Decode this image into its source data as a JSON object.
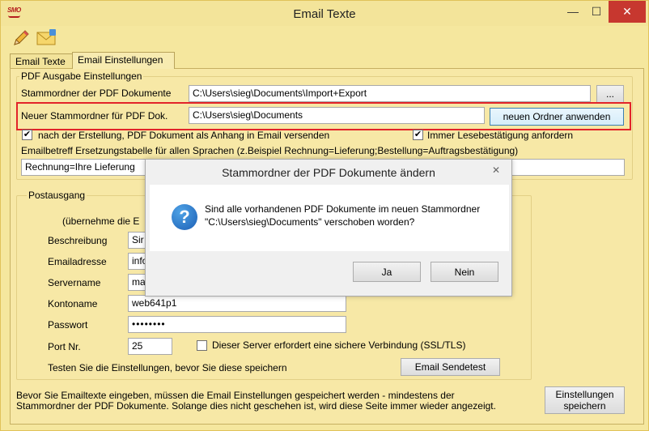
{
  "window": {
    "title": "Email Texte",
    "logo_text": "SMO"
  },
  "title_controls": {
    "minimize": "—",
    "maximize": "☐",
    "close": "✕"
  },
  "toolbar": {
    "edit_icon": "pencil-icon",
    "mail_icon": "envelope-icon"
  },
  "tabs": [
    {
      "label": "Email Texte"
    },
    {
      "label": "Email Einstellungen"
    }
  ],
  "pdf": {
    "group_label": "PDF Ausgabe Einstellungen",
    "root_label": "Stammordner der PDF Dokumente",
    "root_value": "C:\\Users\\sieg\\Documents\\Import+Export",
    "browse_label": "...",
    "new_root_label": "Neuer Stammordner für PDF Dok.",
    "new_root_value": "C:\\Users\\sieg\\Documents",
    "apply_label": "neuen Ordner anwenden",
    "attach_label": "nach der Erstellung,  PDF Dokument als Anhang in Email versenden",
    "receipt_label": "Immer Lesebestätigung anfordern",
    "subject_label": "Emailbetreff Ersetzungstabelle für allen Sprachen (z.Beispiel Rechnung=Lieferung;Bestellung=Auftragsbestätigung)",
    "subject_value": "Rechnung=Ihre Lieferung"
  },
  "outbox": {
    "group_label": "Postausgang",
    "adopt_label": "(übernehme die E",
    "description_label": "Beschreibung",
    "description_value": "Sir",
    "email_label": "Emailadresse",
    "email_value": "info",
    "server_label": "Servername",
    "server_value": "ma",
    "account_label": "Kontoname",
    "account_value": "web641p1",
    "password_label": "Passwort",
    "password_value": "••••••••",
    "port_label": "Port Nr.",
    "port_value": "25",
    "ssl_label": "Dieser Server erfordert eine sichere Verbindung (SSL/TLS)",
    "test_hint": "Testen Sie die Einstellungen, bevor Sie diese speichern",
    "test_button": "Email Sendetest"
  },
  "footer": {
    "note_line1": "Bevor Sie Emailtexte eingeben, müssen die Email Einstellungen gespeichert werden - mindestens der",
    "note_line2": "Stammordner der PDF Dokumente. Solange dies nicht geschehen ist, wird diese Seite immer wieder angezeigt.",
    "save_line1": "Einstellungen",
    "save_line2": "speichern"
  },
  "dialog": {
    "title": "Stammordner der PDF Dokumente ändern",
    "close": "✕",
    "icon": "question-icon",
    "message_line1": "Sind alle vorhandenen PDF Dokumente im neuen Stammordner",
    "message_line2": "\"C:\\Users\\sieg\\Documents\" verschoben worden?",
    "yes_label": "Ja",
    "no_label": "Nein"
  },
  "colors": {
    "accent_highlight": "#e2242a",
    "window_bg": "#f5e79e",
    "close_button": "#c7372f"
  }
}
